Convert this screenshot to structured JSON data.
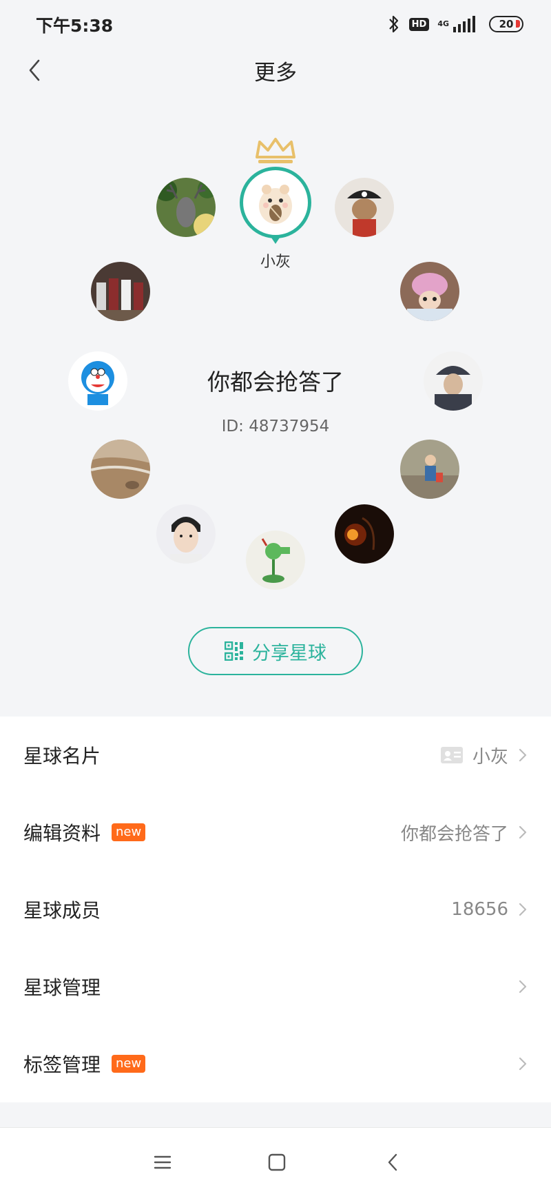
{
  "status": {
    "time": "下午5:38",
    "hd": "HD",
    "network": "4G",
    "battery": "20"
  },
  "nav": {
    "title": "更多"
  },
  "planet": {
    "owner_name": "小灰",
    "group_name": "你都会抢答了",
    "group_id": "ID: 48737954",
    "share_label": "分享星球",
    "colors": {
      "accent": "#2bb39c",
      "crown": "#e8c06a"
    }
  },
  "menu": {
    "items": [
      {
        "label": "星球名片",
        "value": "小灰",
        "icon": "card-icon",
        "badge": ""
      },
      {
        "label": "编辑资料",
        "value": "你都会抢答了",
        "icon": "",
        "badge": "new"
      },
      {
        "label": "星球成员",
        "value": "18656",
        "icon": "",
        "badge": ""
      },
      {
        "label": "星球管理",
        "value": "",
        "icon": "",
        "badge": ""
      },
      {
        "label": "标签管理",
        "value": "",
        "icon": "",
        "badge": "new"
      }
    ],
    "badge_color": "#ff6a1a"
  },
  "system_nav": {
    "icons": [
      "menu-icon",
      "home-icon",
      "back-icon"
    ]
  }
}
